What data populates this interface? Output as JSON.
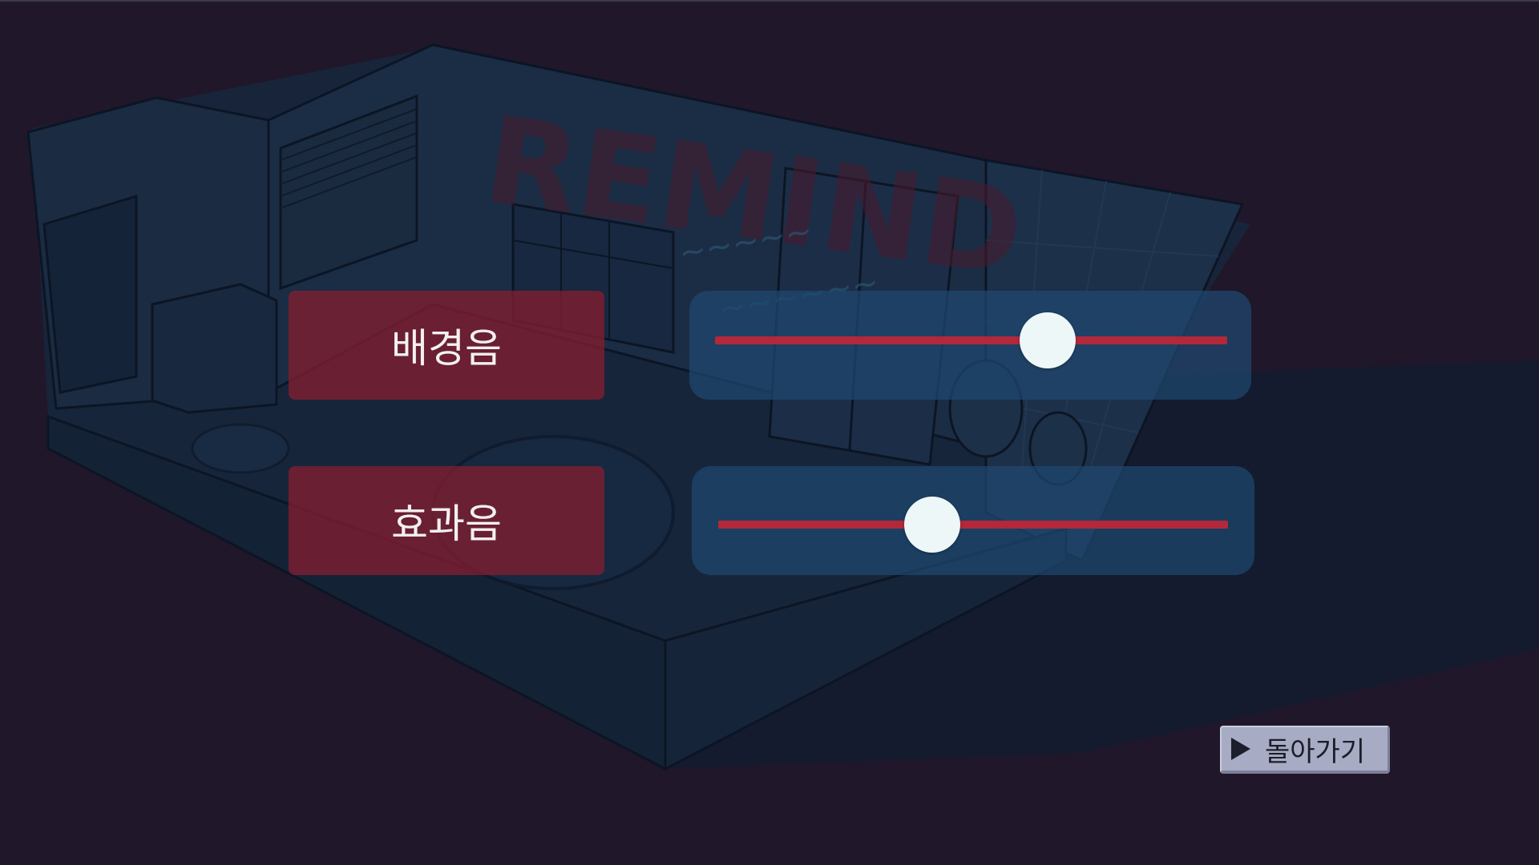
{
  "settings": {
    "bgm": {
      "label": "배경음",
      "volume": 0.65
    },
    "sfx": {
      "label": "효과음",
      "volume": 0.42
    }
  },
  "back_button": {
    "label": "돌아가기",
    "icon": "play-icon"
  },
  "colors": {
    "label_bg": "#821d30",
    "slider_panel_bg": "#1e4870",
    "slider_track": "#b3283a",
    "slider_thumb": "#eef7f8",
    "background": "#20172b"
  }
}
